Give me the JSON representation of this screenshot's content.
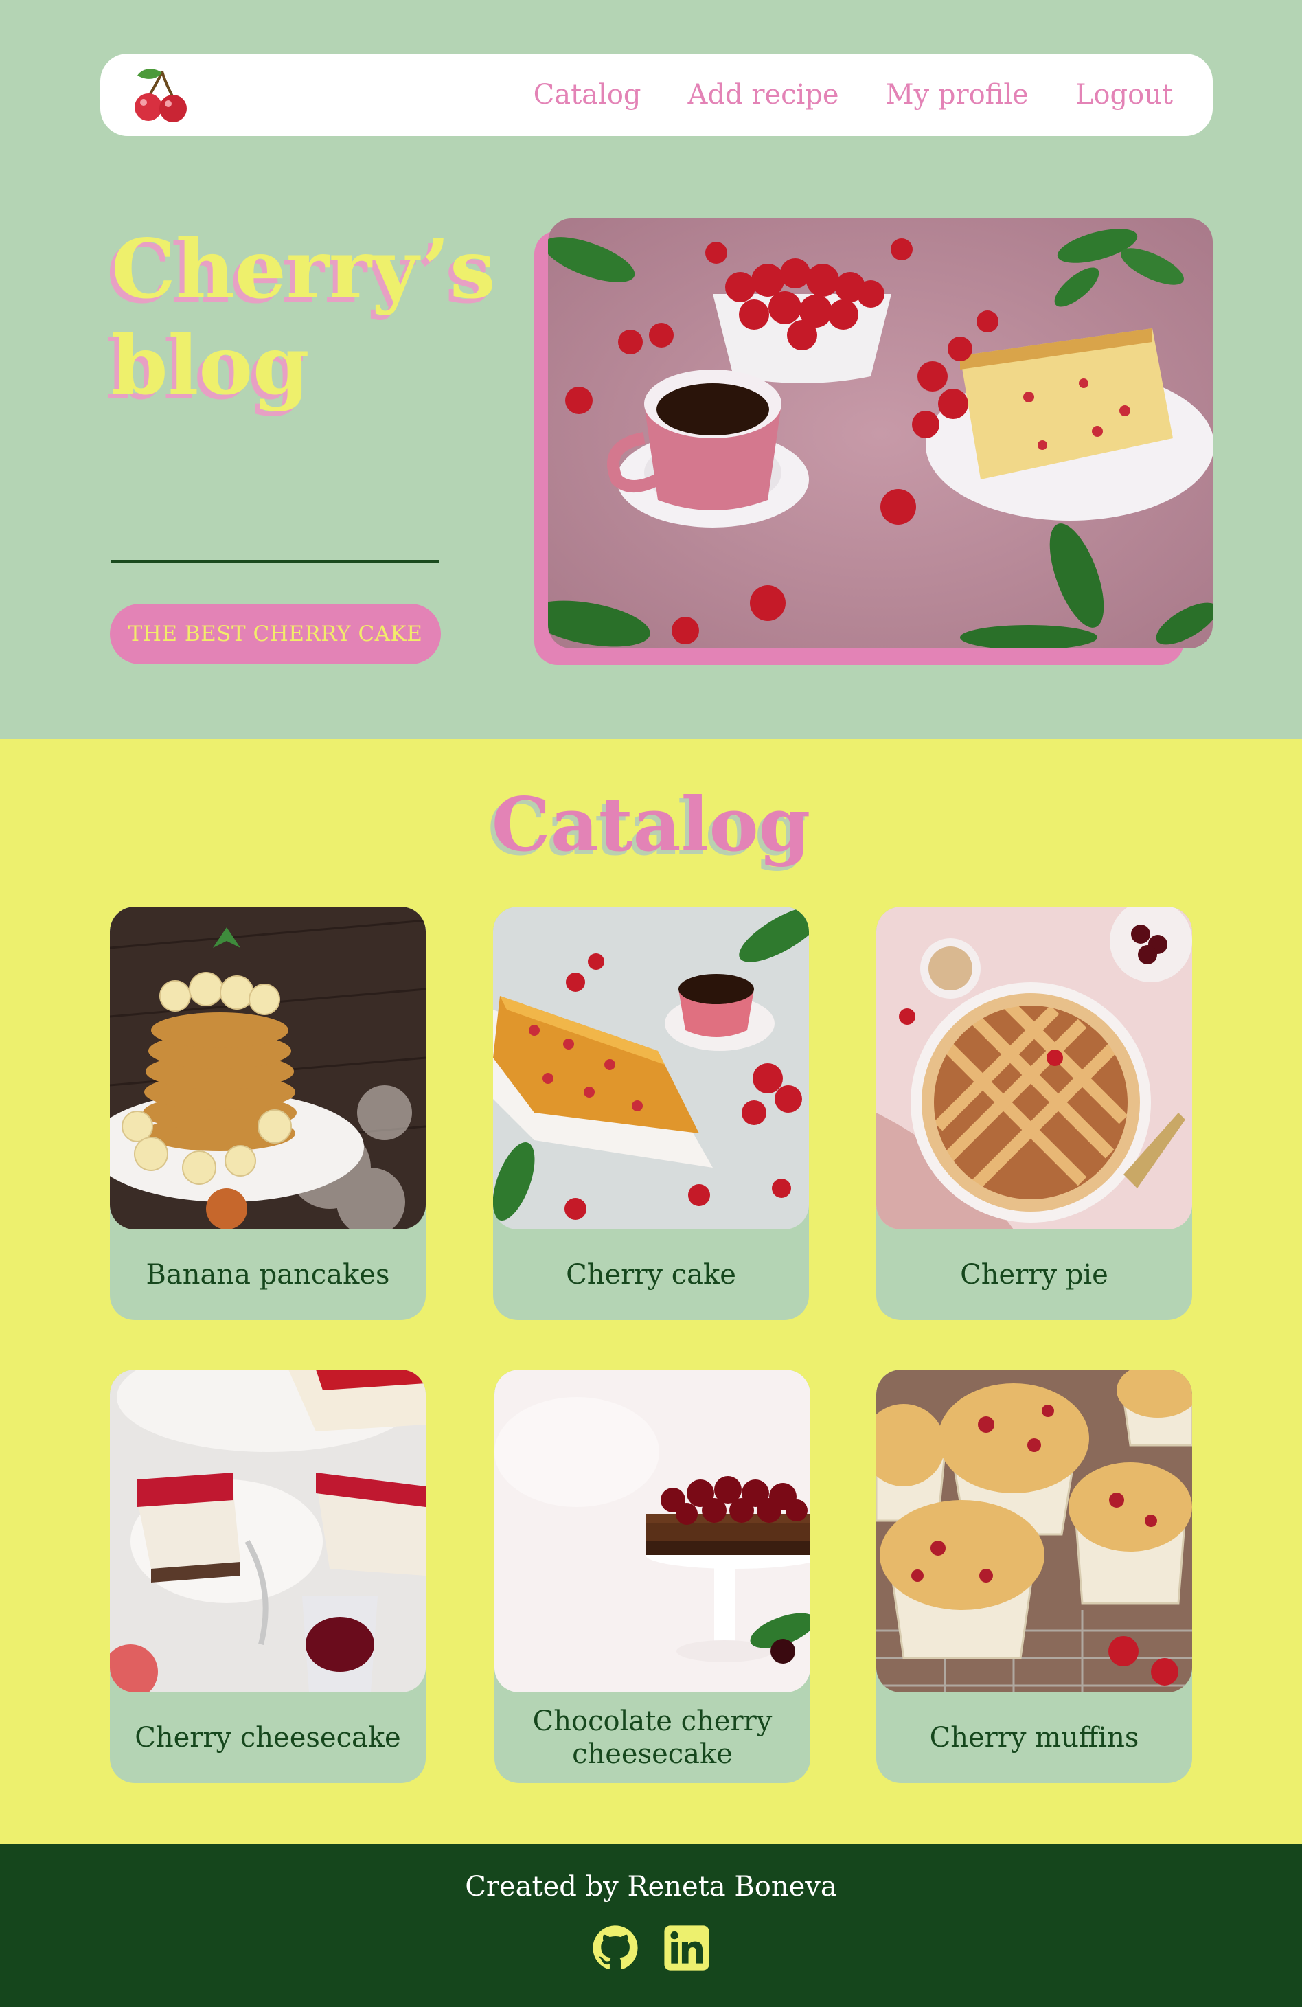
{
  "nav": {
    "logo_icon": "cherry-icon",
    "links": [
      "Catalog",
      "Add recipe",
      "My profile",
      "Logout"
    ]
  },
  "hero": {
    "title_line1": "Cherry’s",
    "title_line2": "blog",
    "button_label": "THE BEST CHERRY CAKE",
    "image": "cherries-coffee-cake-photo"
  },
  "catalog": {
    "title": "Catalog",
    "items": [
      {
        "label": "Banana pancakes",
        "image": "banana-pancakes-photo"
      },
      {
        "label": "Cherry cake",
        "image": "cherry-cake-photo"
      },
      {
        "label": "Cherry pie",
        "image": "cherry-pie-photo"
      },
      {
        "label": "Cherry cheesecake",
        "image": "cherry-cheesecake-photo"
      },
      {
        "label": "Chocolate cherry cheesecake",
        "image": "chocolate-cherry-cheesecake-photo"
      },
      {
        "label": "Cherry muffins",
        "image": "cherry-muffins-photo"
      }
    ]
  },
  "footer": {
    "credit": "Created by Reneta Boneva",
    "icons": [
      "github-icon",
      "linkedin-icon"
    ]
  },
  "colors": {
    "sage": "#b4d4b4",
    "pink": "#e383b6",
    "yellow": "#edf06e",
    "dark_green": "#15461c"
  }
}
